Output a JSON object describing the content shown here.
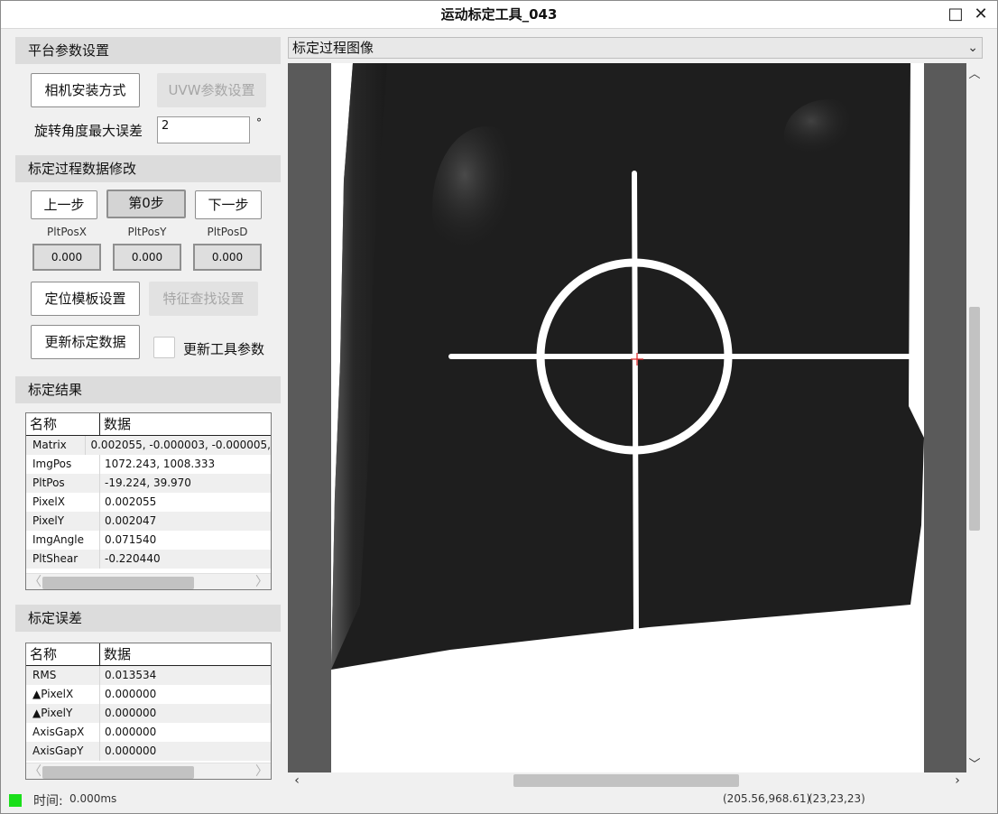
{
  "window": {
    "title": "运动标定工具_043",
    "maximize_icon": "maximize-icon",
    "close_icon": "close-icon"
  },
  "platform": {
    "header": "平台参数设置",
    "camera_mount_button": "相机安装方式",
    "uvw_button": "UVW参数设置",
    "max_angle_error_label": "旋转角度最大误差",
    "max_angle_error_value": "2",
    "degree_unit": "°"
  },
  "process": {
    "header": "标定过程数据修改",
    "prev_button": "上一步",
    "step_button": "第0步",
    "next_button": "下一步",
    "pos_labels": [
      "PltPosX",
      "PltPosY",
      "PltPosD"
    ],
    "pos_values": [
      "0.000",
      "0.000",
      "0.000"
    ],
    "template_button": "定位模板设置",
    "feature_button": "特征查找设置",
    "update_data_button": "更新标定数据",
    "update_tool_label": "更新工具参数",
    "update_tool_checked": false
  },
  "result": {
    "header": "标定结果",
    "col_name": "名称",
    "col_data": "数据",
    "rows": [
      [
        "Matrix",
        "0.002055, -0.000003, -0.000005,"
      ],
      [
        "ImgPos",
        "1072.243, 1008.333"
      ],
      [
        "PltPos",
        "-19.224, 39.970"
      ],
      [
        "PixelX",
        "0.002055"
      ],
      [
        "PixelY",
        "0.002047"
      ],
      [
        "ImgAngle",
        "0.071540"
      ],
      [
        "PltShear",
        "-0.220440"
      ]
    ]
  },
  "error": {
    "header": "标定误差",
    "col_name": "名称",
    "col_data": "数据",
    "rows": [
      [
        "RMS",
        "0.013534"
      ],
      [
        "▲PixelX",
        "0.000000"
      ],
      [
        "▲PixelY",
        "0.000000"
      ],
      [
        "AxisGapX",
        "0.000000"
      ],
      [
        "AxisGapY",
        "0.000000"
      ]
    ]
  },
  "image": {
    "selector_value": "标定过程图像"
  },
  "status": {
    "time_label": "时间:",
    "time_value": "0.000ms",
    "coords": "(205.56,968.61)",
    "rgb": "(23,23,23)",
    "led_color": "#1adf1a"
  }
}
